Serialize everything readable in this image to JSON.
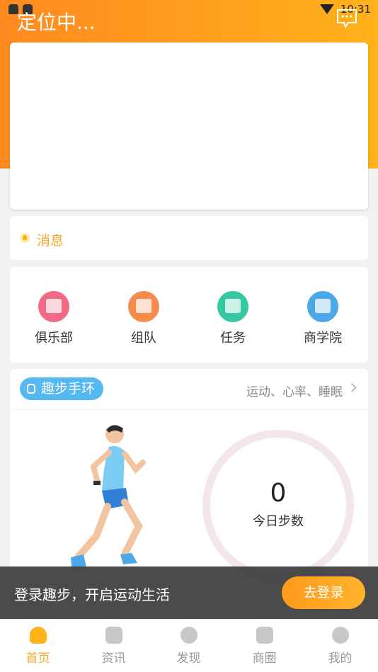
{
  "status_bar": {
    "time": "10:31"
  },
  "header": {
    "location_title": "定位中..."
  },
  "message": {
    "label": "消息"
  },
  "quick_grid": [
    {
      "label": "俱乐部",
      "icon": "club-icon",
      "color": "#f26a86"
    },
    {
      "label": "组队",
      "icon": "team-icon",
      "color": "#f58b4c"
    },
    {
      "label": "任务",
      "icon": "task-icon",
      "color": "#35c9a3"
    },
    {
      "label": "商学院",
      "icon": "book-icon",
      "color": "#4aa9e6"
    }
  ],
  "band": {
    "tag_label": "趣步手环",
    "features": "运动、心率、睡眠",
    "steps_value": "0",
    "steps_label": "今日步数"
  },
  "login_prompt": {
    "text": "登录趣步，开启运动生活",
    "button": "去登录"
  },
  "tabs": [
    {
      "label": "首页",
      "icon": "home-icon",
      "active": true
    },
    {
      "label": "资讯",
      "icon": "news-icon",
      "active": false
    },
    {
      "label": "发现",
      "icon": "discover-icon",
      "active": false
    },
    {
      "label": "商圈",
      "icon": "shop-icon",
      "active": false
    },
    {
      "label": "我的",
      "icon": "profile-icon",
      "active": false
    }
  ],
  "colors": {
    "accent": "#ffb21a",
    "header_start": "#ff8a1f",
    "band_tag": "#55b8f0"
  }
}
